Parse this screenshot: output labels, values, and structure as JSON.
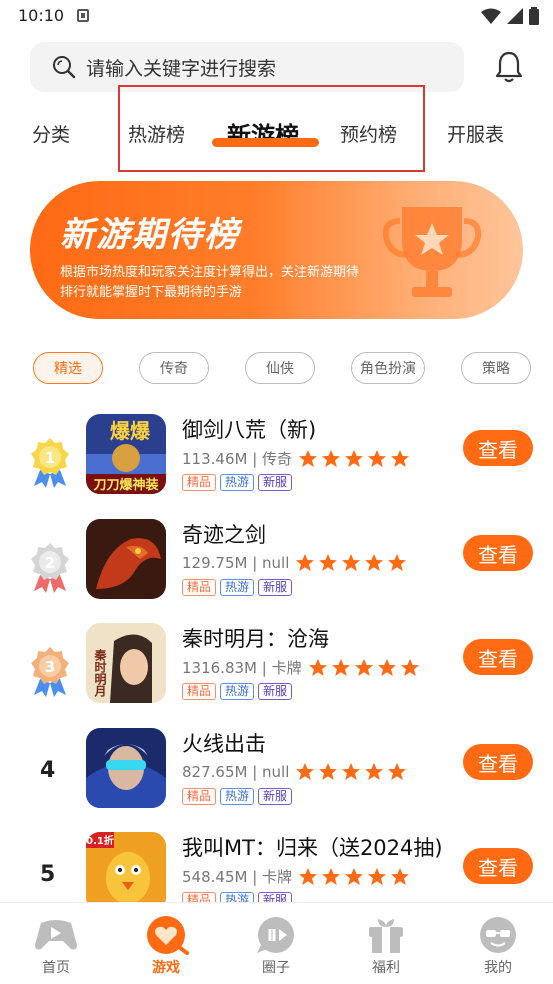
{
  "status_bar": {
    "time": "10:10"
  },
  "search": {
    "placeholder": "请输入关键字进行搜索"
  },
  "tabs": [
    {
      "label": "分类",
      "active": false
    },
    {
      "label": "热游榜",
      "active": false
    },
    {
      "label": "新游榜",
      "active": true
    },
    {
      "label": "预约榜",
      "active": false
    },
    {
      "label": "开服表",
      "active": false
    }
  ],
  "banner": {
    "title": "新游期待榜",
    "description": "根据市场热度和玩家关注度计算得出，关注新游期待排行就能掌握时下最期待的手游"
  },
  "chips": [
    {
      "label": "精选",
      "active": true
    },
    {
      "label": "传奇",
      "active": false
    },
    {
      "label": "仙侠",
      "active": false
    },
    {
      "label": "角色扮演",
      "active": false
    },
    {
      "label": "策略",
      "active": false
    }
  ],
  "games": [
    {
      "rank": "1",
      "name": "御剑八荒（新)",
      "size": "113.46M",
      "category": "传奇",
      "rating": 5,
      "tags": [
        "精品",
        "热游",
        "新服"
      ],
      "button": "查看"
    },
    {
      "rank": "2",
      "name": "奇迹之剑",
      "size": "129.75M",
      "category": "null",
      "rating": 5,
      "tags": [
        "精品",
        "热游",
        "新服"
      ],
      "button": "查看"
    },
    {
      "rank": "3",
      "name": "秦时明月：沧海",
      "size": "1316.83M",
      "category": "卡牌",
      "rating": 5,
      "tags": [
        "精品",
        "热游",
        "新服"
      ],
      "button": "查看"
    },
    {
      "rank": "4",
      "name": "火线出击",
      "size": "827.65M",
      "category": "null",
      "rating": 5,
      "tags": [
        "精品",
        "热游",
        "新服"
      ],
      "button": "查看"
    },
    {
      "rank": "5",
      "name": "我叫MT：归来（送2024抽)",
      "size": "548.45M",
      "category": "卡牌",
      "rating": 5,
      "tags": [
        "精品",
        "热游",
        "新服"
      ],
      "button": "查看"
    }
  ],
  "icon_texts": {
    "game1": "爆爆",
    "game1_banner": "刀刀爆神装",
    "game3": "秦时明月",
    "game5": "0.1折"
  },
  "bottom_nav": [
    {
      "label": "首页",
      "icon": "gamepad-icon",
      "active": false
    },
    {
      "label": "游戏",
      "icon": "game-heart-icon",
      "active": true
    },
    {
      "label": "圈子",
      "icon": "chat-icon",
      "active": false
    },
    {
      "label": "福利",
      "icon": "gift-icon",
      "active": false
    },
    {
      "label": "我的",
      "icon": "profile-icon",
      "active": false
    }
  ],
  "colors": {
    "accent": "#ff6a13",
    "star": "#ff6a13"
  }
}
